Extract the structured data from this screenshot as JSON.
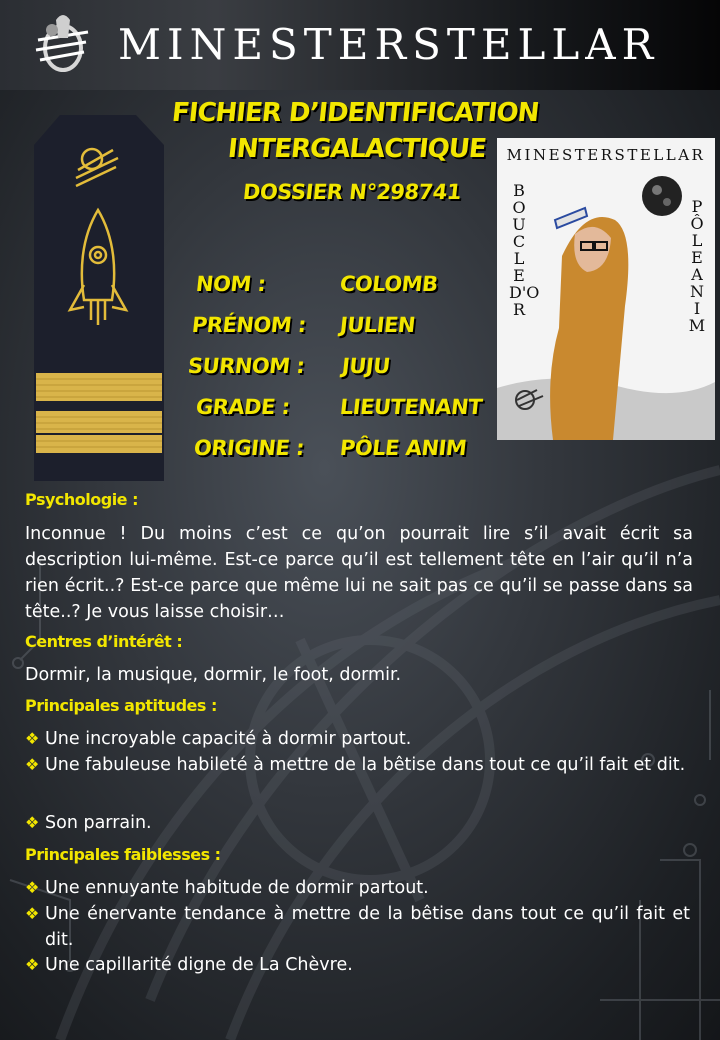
{
  "header": {
    "brand": "MINESTERSTELLAR"
  },
  "title": {
    "line1": "FICHIER D’IDENTIFICATION",
    "line2": "INTERGALACTIQUE",
    "dossier": "DOSSIER N°298741"
  },
  "identity": [
    {
      "label": "NOM :",
      "value": "COLOMB"
    },
    {
      "label": "PRÉNOM :",
      "value": "JULIEN"
    },
    {
      "label": "SURNOM :",
      "value": "JUJU"
    },
    {
      "label": "GRADE :",
      "value": "LIEUTENANT"
    },
    {
      "label": "ORIGINE :",
      "value": "PÔLE ANIM"
    }
  ],
  "photo": {
    "brand": "MINESTERSTELLAR",
    "left_vertical": "BOUCLE D'OR",
    "right_vertical": "PÔLE ANIM"
  },
  "sections": {
    "psychologie": {
      "title": "Psychologie :",
      "text": "Inconnue ! Du moins c’est ce qu’on pourrait lire s’il avait écrit sa description lui-même. Est-ce parce qu’il est tellement tête en l’air qu’il n’a rien écrit..? Est-ce parce que même lui ne sait pas ce qu’il se passe dans sa tête..? Je vous laisse choisir…"
    },
    "interets": {
      "title": "Centres d’intérêt :",
      "text": "Dormir, la musique, dormir, le foot, dormir."
    },
    "aptitudes": {
      "title": "Principales aptitudes :",
      "items": [
        "Une incroyable capacité à dormir partout.",
        "Une fabuleuse habileté à mettre de la bêtise dans tout ce qu’il fait et dit.",
        "Son parrain."
      ]
    },
    "faiblesses": {
      "title": "Principales faiblesses :",
      "items": [
        "Une ennuyante habitude de dormir partout.",
        "Une énervante tendance à mettre de la bêtise dans tout ce qu’il fait et dit.",
        "Une capillarité digne de La Chèvre."
      ]
    }
  },
  "colors": {
    "accent": "#f2e600",
    "text": "#ffffff",
    "background": "#2c3035"
  },
  "icons": {
    "bullet": "diamond-bullet-icon",
    "logo": "rocket-logo-icon",
    "epaulette": "epaulette-insignia-icon"
  }
}
